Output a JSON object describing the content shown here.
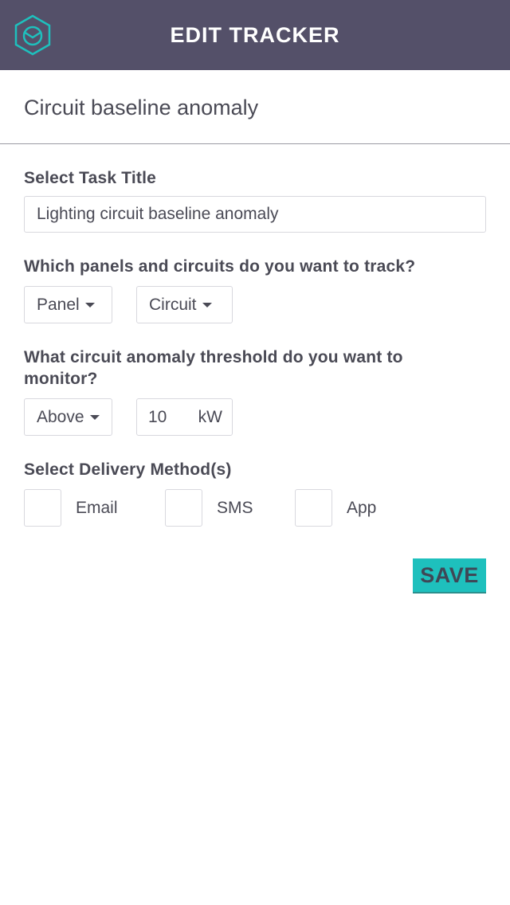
{
  "header": {
    "title": "EDIT TRACKER",
    "logo_icon": "hexagon-clock-logo-icon"
  },
  "tracker": {
    "name": "Circuit baseline anomaly"
  },
  "task_title": {
    "label": "Select Task Title",
    "value": "Lighting circuit baseline anomaly"
  },
  "tracking": {
    "label": "Which panels and circuits do you want to track?",
    "panel": "Panel",
    "circuit": "Circuit"
  },
  "threshold": {
    "label_line1": "What circuit anomaly threshold do you want to",
    "label_line2": "monitor?",
    "direction": "Above",
    "value": "10",
    "unit": "kW"
  },
  "delivery": {
    "label": "Select Delivery Method(s)",
    "email": "Email",
    "sms": "SMS",
    "app": "App"
  },
  "actions": {
    "save": "SAVE"
  },
  "colors": {
    "header_bg": "#545069",
    "accent": "#1ec0bd",
    "text": "#4a4a55"
  }
}
